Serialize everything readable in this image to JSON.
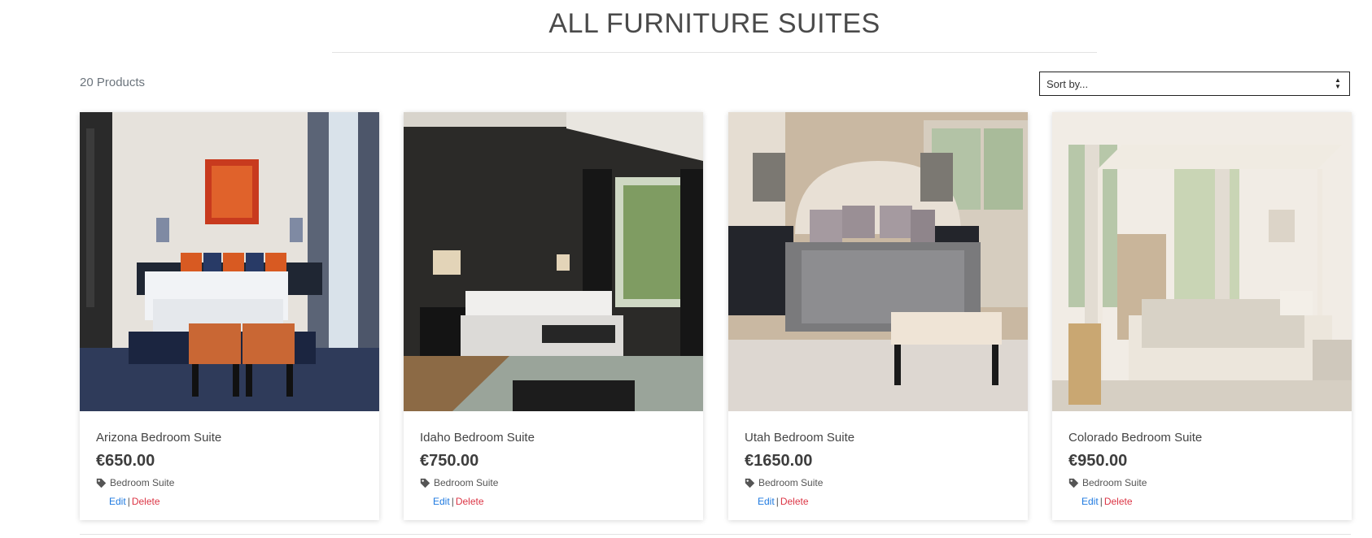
{
  "page": {
    "title": "ALL FURNITURE SUITES",
    "product_count": "20 Products"
  },
  "sort": {
    "placeholder": "Sort by...",
    "icon": "sort-arrows-icon"
  },
  "products": [
    {
      "name": "Arizona Bedroom Suite",
      "price": "€650.00",
      "category": "Bedroom Suite",
      "edit_label": "Edit",
      "sep": "|",
      "delete_label": "Delete"
    },
    {
      "name": "Idaho Bedroom Suite",
      "price": "€750.00",
      "category": "Bedroom Suite",
      "edit_label": "Edit",
      "sep": "|",
      "delete_label": "Delete"
    },
    {
      "name": "Utah Bedroom Suite",
      "price": "€1650.00",
      "category": "Bedroom Suite",
      "edit_label": "Edit",
      "sep": "|",
      "delete_label": "Delete"
    },
    {
      "name": "Colorado Bedroom Suite",
      "price": "€950.00",
      "category": "Bedroom Suite",
      "edit_label": "Edit",
      "sep": "|",
      "delete_label": "Delete"
    }
  ],
  "colors": {
    "edit_link": "#1f7ae0",
    "delete_link": "#dc3545"
  }
}
